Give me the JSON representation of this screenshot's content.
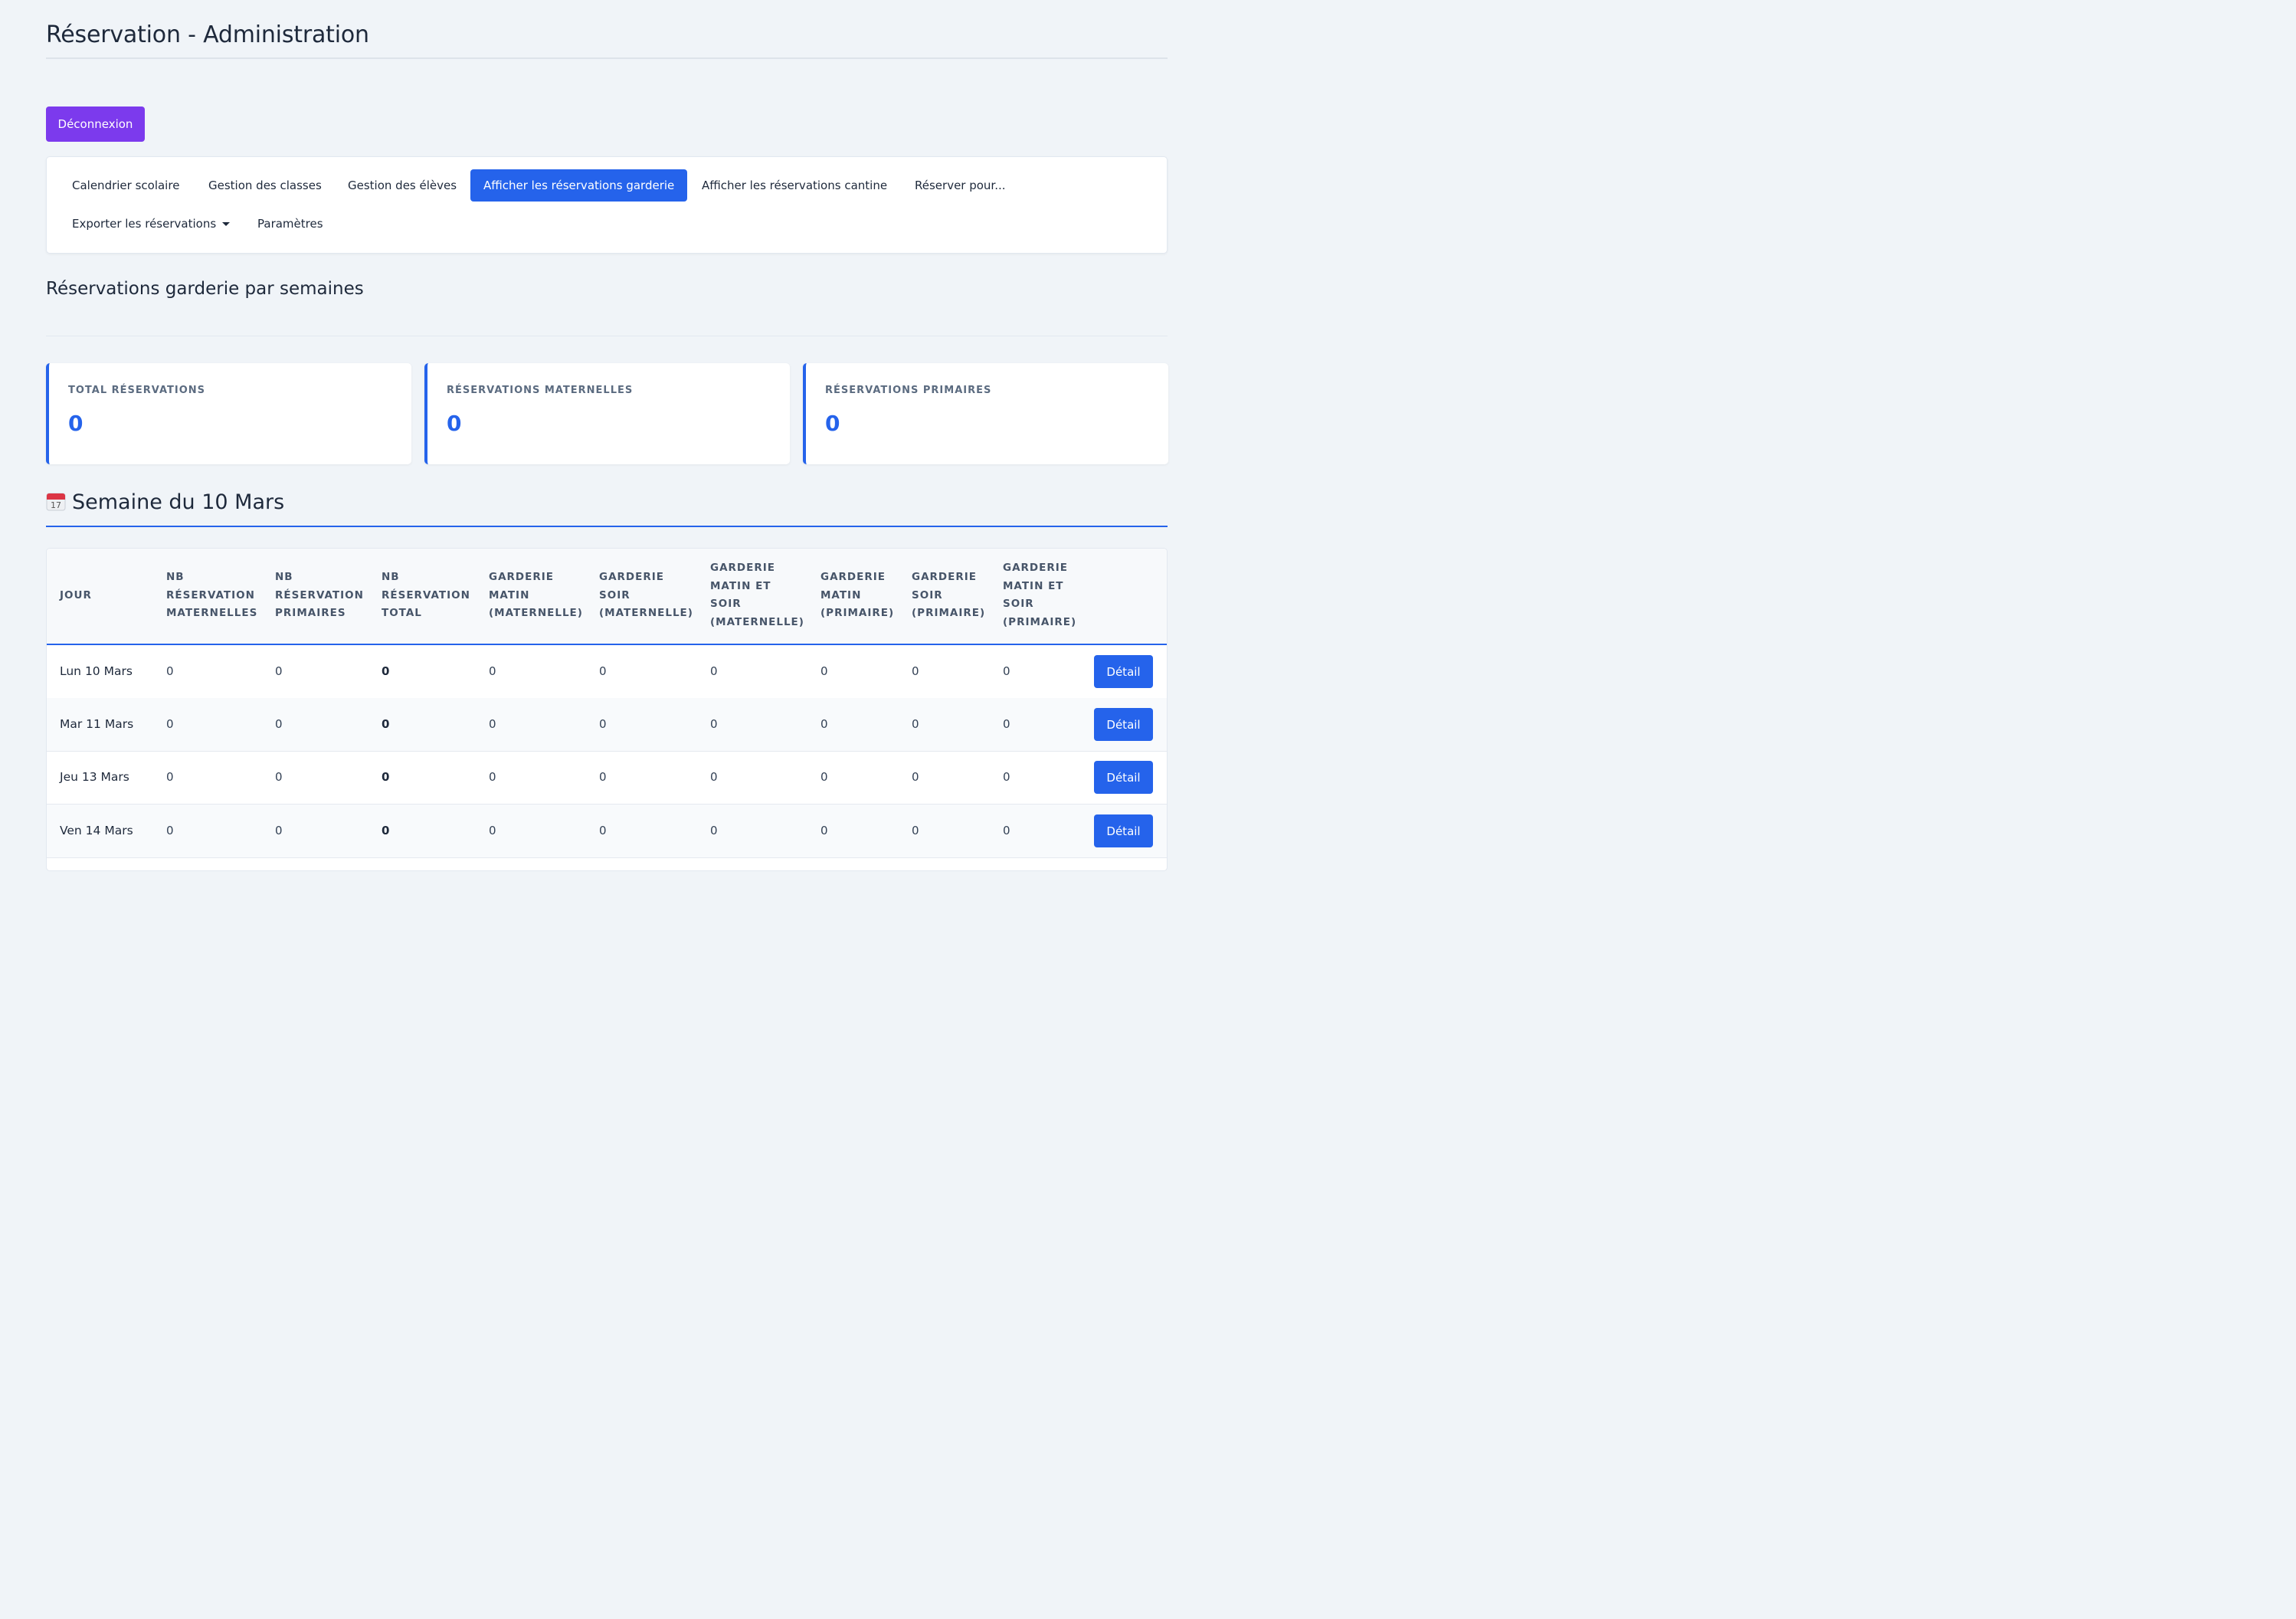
{
  "page": {
    "title": "Réservation - Administration"
  },
  "logout_label": "Déconnexion",
  "nav": {
    "items": [
      {
        "label": "Calendrier scolaire"
      },
      {
        "label": "Gestion des classes"
      },
      {
        "label": "Gestion des élèves"
      },
      {
        "label": "Afficher les réservations garderie",
        "active": true
      },
      {
        "label": "Afficher les réservations cantine"
      },
      {
        "label": "Réserver pour..."
      },
      {
        "label": "Exporter les réservations",
        "dropdown": true
      },
      {
        "label": "Paramètres"
      }
    ]
  },
  "section": {
    "title": "Réservations garderie par semaines"
  },
  "stats": [
    {
      "label": "TOTAL RÉSERVATIONS",
      "value": "0"
    },
    {
      "label": "RÉSERVATIONS MATERNELLES",
      "value": "0"
    },
    {
      "label": "RÉSERVATIONS PRIMAIRES",
      "value": "0"
    }
  ],
  "week": {
    "title": "Semaine du 10 Mars",
    "icon": "calendar-icon"
  },
  "table": {
    "headers": [
      "JOUR",
      "NB RÉSERVATION MATERNELLES",
      "NB RÉSERVATION PRIMAIRES",
      "NB RÉSERVATION TOTAL",
      "GARDERIE MATIN (MATERNELLE)",
      "GARDERIE SOIR (MATERNELLE)",
      "GARDERIE MATIN ET SOIR (MATERNELLE)",
      "GARDERIE MATIN (PRIMAIRE)",
      "GARDERIE SOIR (PRIMAIRE)",
      "GARDERIE MATIN ET SOIR (PRIMAIRE)"
    ],
    "rows": [
      {
        "day": "Lun 10 Mars",
        "values": [
          "0",
          "0",
          "0",
          "0",
          "0",
          "0",
          "0",
          "0",
          "0"
        ],
        "action": "Détail"
      },
      {
        "day": "Mar 11 Mars",
        "values": [
          "0",
          "0",
          "0",
          "0",
          "0",
          "0",
          "0",
          "0",
          "0"
        ],
        "action": "Détail"
      },
      {
        "day": "Jeu 13 Mars",
        "values": [
          "0",
          "0",
          "0",
          "0",
          "0",
          "0",
          "0",
          "0",
          "0"
        ],
        "action": "Détail"
      },
      {
        "day": "Ven 14 Mars",
        "values": [
          "0",
          "0",
          "0",
          "0",
          "0",
          "0",
          "0",
          "0",
          "0"
        ],
        "action": "Détail"
      }
    ]
  },
  "colors": {
    "accent": "#2563eb",
    "logout": "#7c3aed",
    "background": "#f0f4f8"
  }
}
